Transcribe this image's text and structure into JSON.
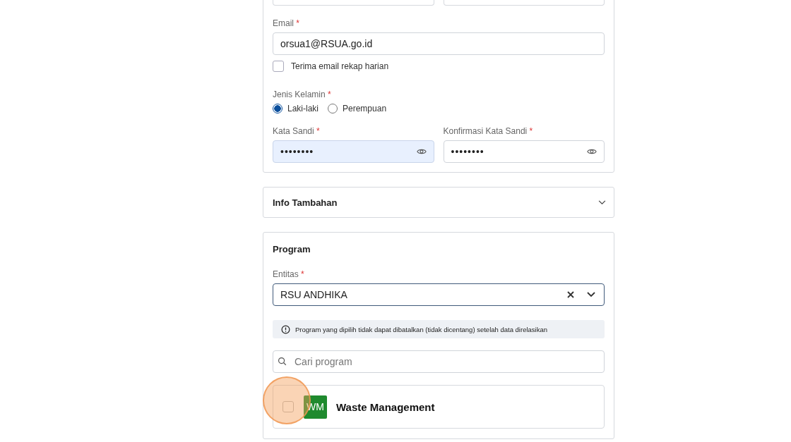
{
  "account_card": {
    "email": {
      "label": "Email",
      "required_mark": "*",
      "value": "orsua1@RSUA.go.id"
    },
    "daily_recap": {
      "label": "Terima email rekap harian",
      "checked": false
    },
    "gender": {
      "label": "Jenis Kelamin",
      "required_mark": "*",
      "options": [
        {
          "label": "Laki-laki",
          "selected": true
        },
        {
          "label": "Perempuan",
          "selected": false
        }
      ]
    },
    "passwords": [
      {
        "label": "Kata Sandi",
        "required_mark": "*",
        "value": "••••••••",
        "focused": true
      },
      {
        "label": "Konfirmasi Kata Sandi",
        "required_mark": "*",
        "value": "••••••••",
        "focused": false
      }
    ]
  },
  "extra_info": {
    "title": "Info Tambahan",
    "expanded": false
  },
  "program_card": {
    "title": "Program",
    "entity": {
      "label": "Entitas",
      "required_mark": "*",
      "value": "RSU ANDHIKA"
    },
    "notice": "Program yang dipilih tidak dapat dibatalkan (tidak dicentang) setelah data direlasikan",
    "search": {
      "placeholder": "Cari program"
    },
    "programs": [
      {
        "initials": "WM",
        "name": "Waste Management",
        "checked": false,
        "color": "#1f8a2e"
      }
    ]
  }
}
